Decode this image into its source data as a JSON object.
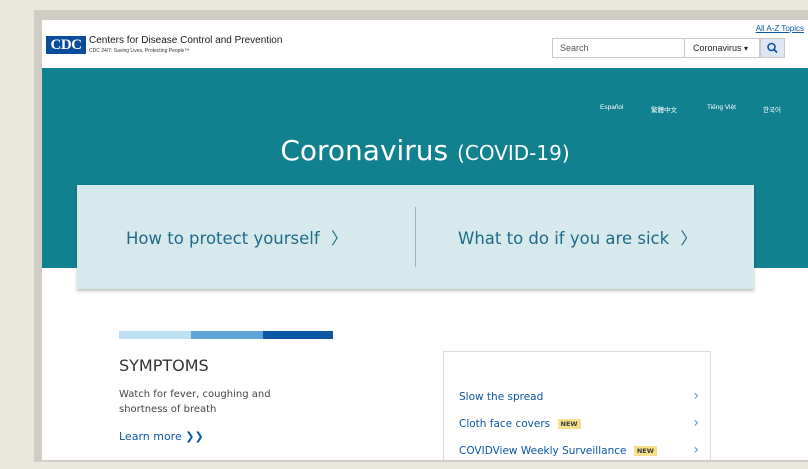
{
  "header": {
    "logo_text": "CDC",
    "agency_name": "Centers for Disease Control and Prevention",
    "tagline": "CDC 24/7: Saving Lives, Protecting People™",
    "az_link": "All A-Z Topics",
    "search_placeholder": "Search",
    "search_scope": "Coronavirus",
    "search_scope_caret": "▾"
  },
  "languages": [
    "Español",
    "繁體中文",
    "Tiếng Việt",
    "한국어"
  ],
  "hero": {
    "title_main": "Coronavirus",
    "title_sub": "(COVID-19)",
    "cards": [
      {
        "label": "How to protect yourself",
        "chevron": "〉"
      },
      {
        "label": "What to do if you are sick",
        "chevron": "〉"
      }
    ]
  },
  "symptoms": {
    "title": "SYMPTOMS",
    "text": "Watch for fever, coughing and shortness of breath",
    "learn_more": "Learn more",
    "learn_more_arrow": "❯❯"
  },
  "links": [
    {
      "label": "Slow the spread",
      "badge": ""
    },
    {
      "label": "Cloth face covers",
      "badge": "NEW"
    },
    {
      "label": "COVIDView Weekly Surveillance",
      "badge": "NEW"
    }
  ],
  "colors": {
    "hero_teal": "#11808f",
    "card_bg": "#d6eaee",
    "link_blue": "#0b57a4",
    "bar_light": "#bde0f5",
    "bar_mid": "#5ea4d8",
    "bar_dark": "#0b57a4",
    "badge_yellow": "#f7e08c"
  },
  "icons": {
    "search_button": "search-icon",
    "link_chevron": "chevron-right-icon"
  }
}
